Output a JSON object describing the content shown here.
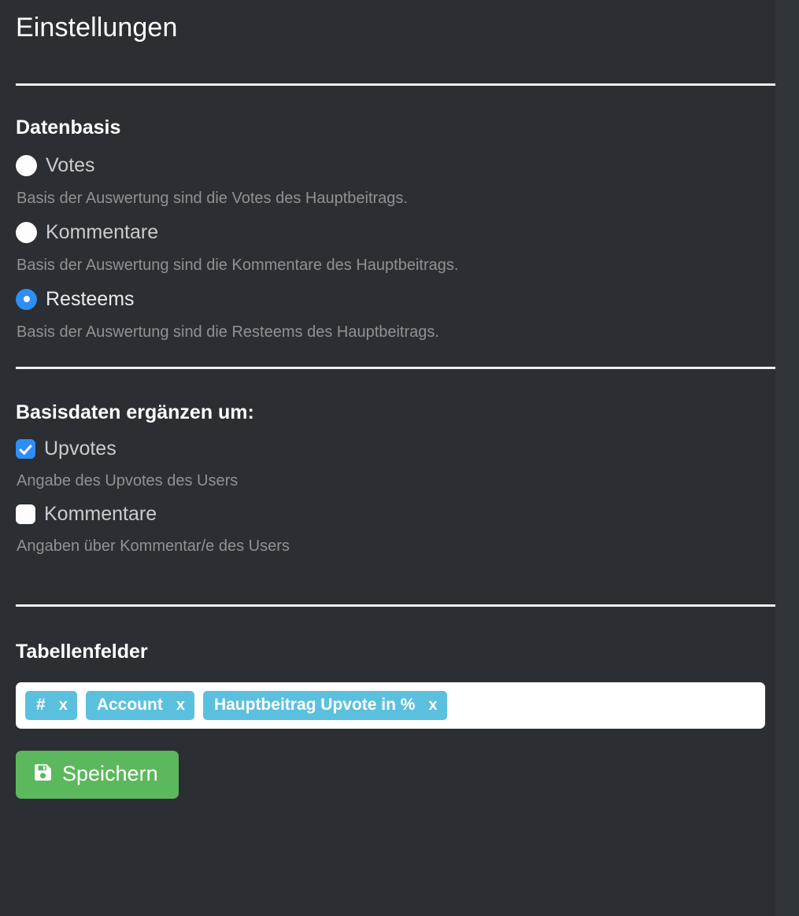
{
  "page": {
    "title": "Einstellungen"
  },
  "datenbasis": {
    "heading": "Datenbasis",
    "options": [
      {
        "label": "Votes",
        "description": "Basis der Auswertung sind die Votes des Hauptbeitrags.",
        "selected": false
      },
      {
        "label": "Kommentare",
        "description": "Basis der Auswertung sind die Kommentare des Hauptbeitrags.",
        "selected": false
      },
      {
        "label": "Resteems",
        "description": "Basis der Auswertung sind die Resteems des Hauptbeitrags.",
        "selected": true
      }
    ]
  },
  "erganzen": {
    "heading": "Basisdaten ergänzen um:",
    "options": [
      {
        "label": "Upvotes",
        "description": "Angabe des Upvotes des Users",
        "checked": true
      },
      {
        "label": "Kommentare",
        "description": "Angaben über Kommentar/e des Users",
        "checked": false
      }
    ]
  },
  "tabellenfelder": {
    "heading": "Tabellenfelder",
    "tokens": [
      {
        "label": "#",
        "remove": "x"
      },
      {
        "label": "Account",
        "remove": "x"
      },
      {
        "label": "Hauptbeitrag Upvote in %",
        "remove": "x"
      }
    ]
  },
  "actions": {
    "save_label": "Speichern",
    "save_icon": "floppy-disk-save-icon"
  },
  "colors": {
    "background": "#2b2f33",
    "accent_blue": "#2f8ef4",
    "token_blue": "#5bc0de",
    "save_green": "#5cb85c",
    "divider": "#eceff1",
    "label": "#c9cccf",
    "description": "#8f9295"
  }
}
